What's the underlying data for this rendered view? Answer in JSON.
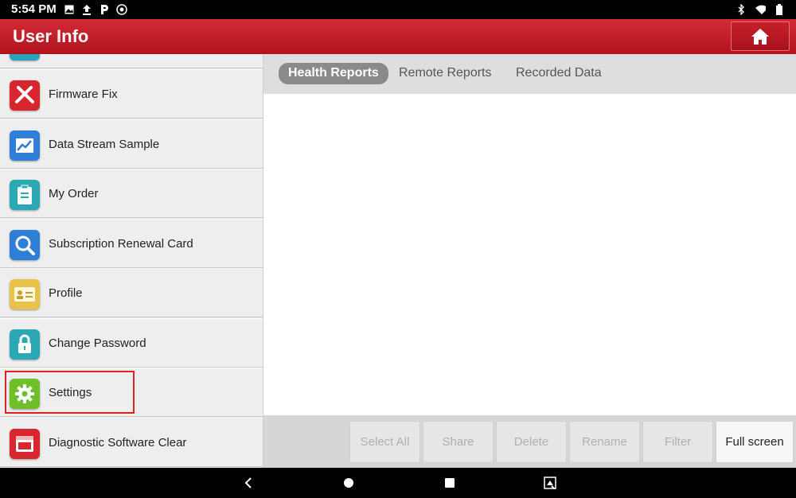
{
  "status_bar": {
    "time": "5:54 PM",
    "icons_left": [
      "image-icon",
      "upload-icon",
      "p-icon",
      "sync-icon"
    ],
    "icons_right": [
      "bluetooth-icon",
      "wifi-icon",
      "battery-icon"
    ]
  },
  "header": {
    "title": "User Info",
    "home_icon": "home-icon"
  },
  "sidebar": {
    "items": [
      {
        "label": "",
        "icon": "partial-icon",
        "color": "#2aa3b8"
      },
      {
        "label": "Firmware Fix",
        "icon": "tools-icon",
        "color": "#d8262e"
      },
      {
        "label": "Data Stream Sample",
        "icon": "chart-icon",
        "color": "#2f7fd6"
      },
      {
        "label": "My Order",
        "icon": "clipboard-icon",
        "color": "#2aa9b5"
      },
      {
        "label": "Subscription Renewal Card",
        "icon": "magnifier-icon",
        "color": "#2f7fd6"
      },
      {
        "label": "Profile",
        "icon": "id-card-icon",
        "color": "#e9c24a"
      },
      {
        "label": "Change Password",
        "icon": "lock-icon",
        "color": "#2aa9b5"
      },
      {
        "label": "Settings",
        "icon": "gear-icon",
        "color": "#6fbf2a"
      },
      {
        "label": "Diagnostic Software Clear",
        "icon": "window-icon",
        "color": "#d8262e"
      }
    ]
  },
  "tabs": [
    "Health Reports",
    "Remote Reports",
    "Recorded Data"
  ],
  "active_tab": "Health Reports",
  "actions": {
    "select_all": "Select All",
    "share": "Share",
    "delete": "Delete",
    "rename": "Rename",
    "filter": "Filter",
    "full_screen": "Full screen"
  },
  "nav_bar": [
    "back-icon",
    "home-circle-icon",
    "recents-icon",
    "screenshot-icon"
  ],
  "colors": {
    "accent": "#c41a24",
    "highlight": "#e02020"
  }
}
